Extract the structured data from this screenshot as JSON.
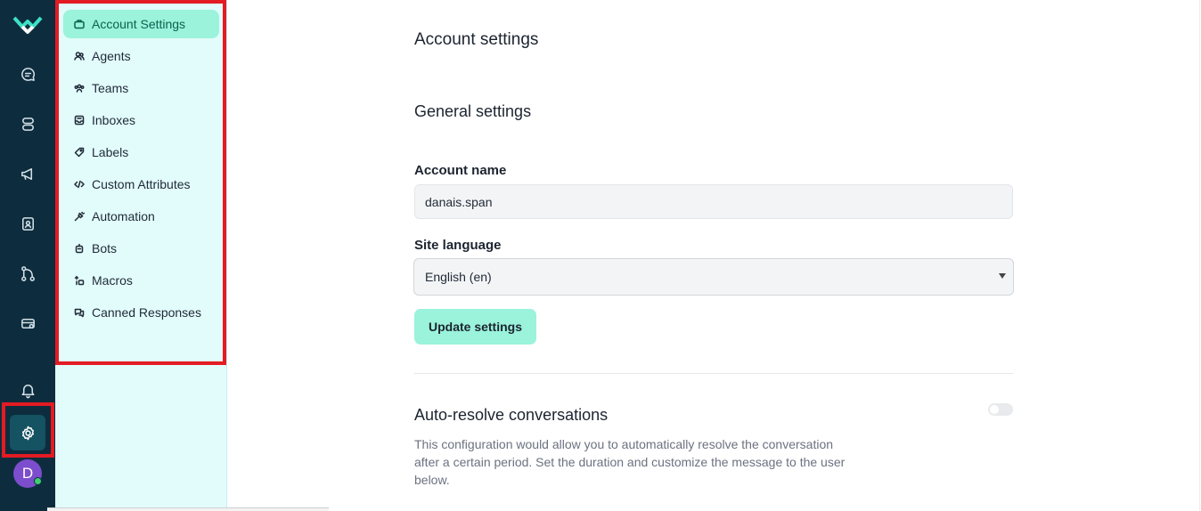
{
  "rail": {
    "items": [
      {
        "name": "conversations-icon"
      },
      {
        "name": "capture-icon"
      },
      {
        "name": "campaigns-icon"
      },
      {
        "name": "contacts-icon"
      },
      {
        "name": "integrations-icon"
      },
      {
        "name": "billing-icon"
      },
      {
        "name": "notifications-icon"
      },
      {
        "name": "settings-icon"
      }
    ],
    "avatar_initial": "D"
  },
  "sidebar": {
    "items": [
      {
        "label": "Account Settings",
        "icon": "briefcase-icon",
        "active": true
      },
      {
        "label": "Agents",
        "icon": "people-icon"
      },
      {
        "label": "Teams",
        "icon": "team-icon"
      },
      {
        "label": "Inboxes",
        "icon": "inbox-icon"
      },
      {
        "label": "Labels",
        "icon": "tag-icon"
      },
      {
        "label": "Custom Attributes",
        "icon": "code-icon"
      },
      {
        "label": "Automation",
        "icon": "automation-icon"
      },
      {
        "label": "Bots",
        "icon": "bot-icon"
      },
      {
        "label": "Macros",
        "icon": "macro-icon"
      },
      {
        "label": "Canned Responses",
        "icon": "chat-bubbles-icon"
      }
    ]
  },
  "main": {
    "page_title": "Account settings",
    "general_title": "General settings",
    "account_name_label": "Account name",
    "account_name_value": "danais.span",
    "site_language_label": "Site language",
    "site_language_value": "English (en)",
    "update_button": "Update settings",
    "auto_resolve_title": "Auto-resolve conversations",
    "auto_resolve_desc": "This configuration would allow you to automatically resolve the conversation after a certain period. Set the duration and customize the message to the user below.",
    "auto_resolve_enabled": false
  },
  "colors": {
    "rail_bg": "#0d2d3e",
    "sidebar_bg": "#e2fbfb",
    "accent": "#9af3da",
    "highlight": "#e31b23"
  }
}
